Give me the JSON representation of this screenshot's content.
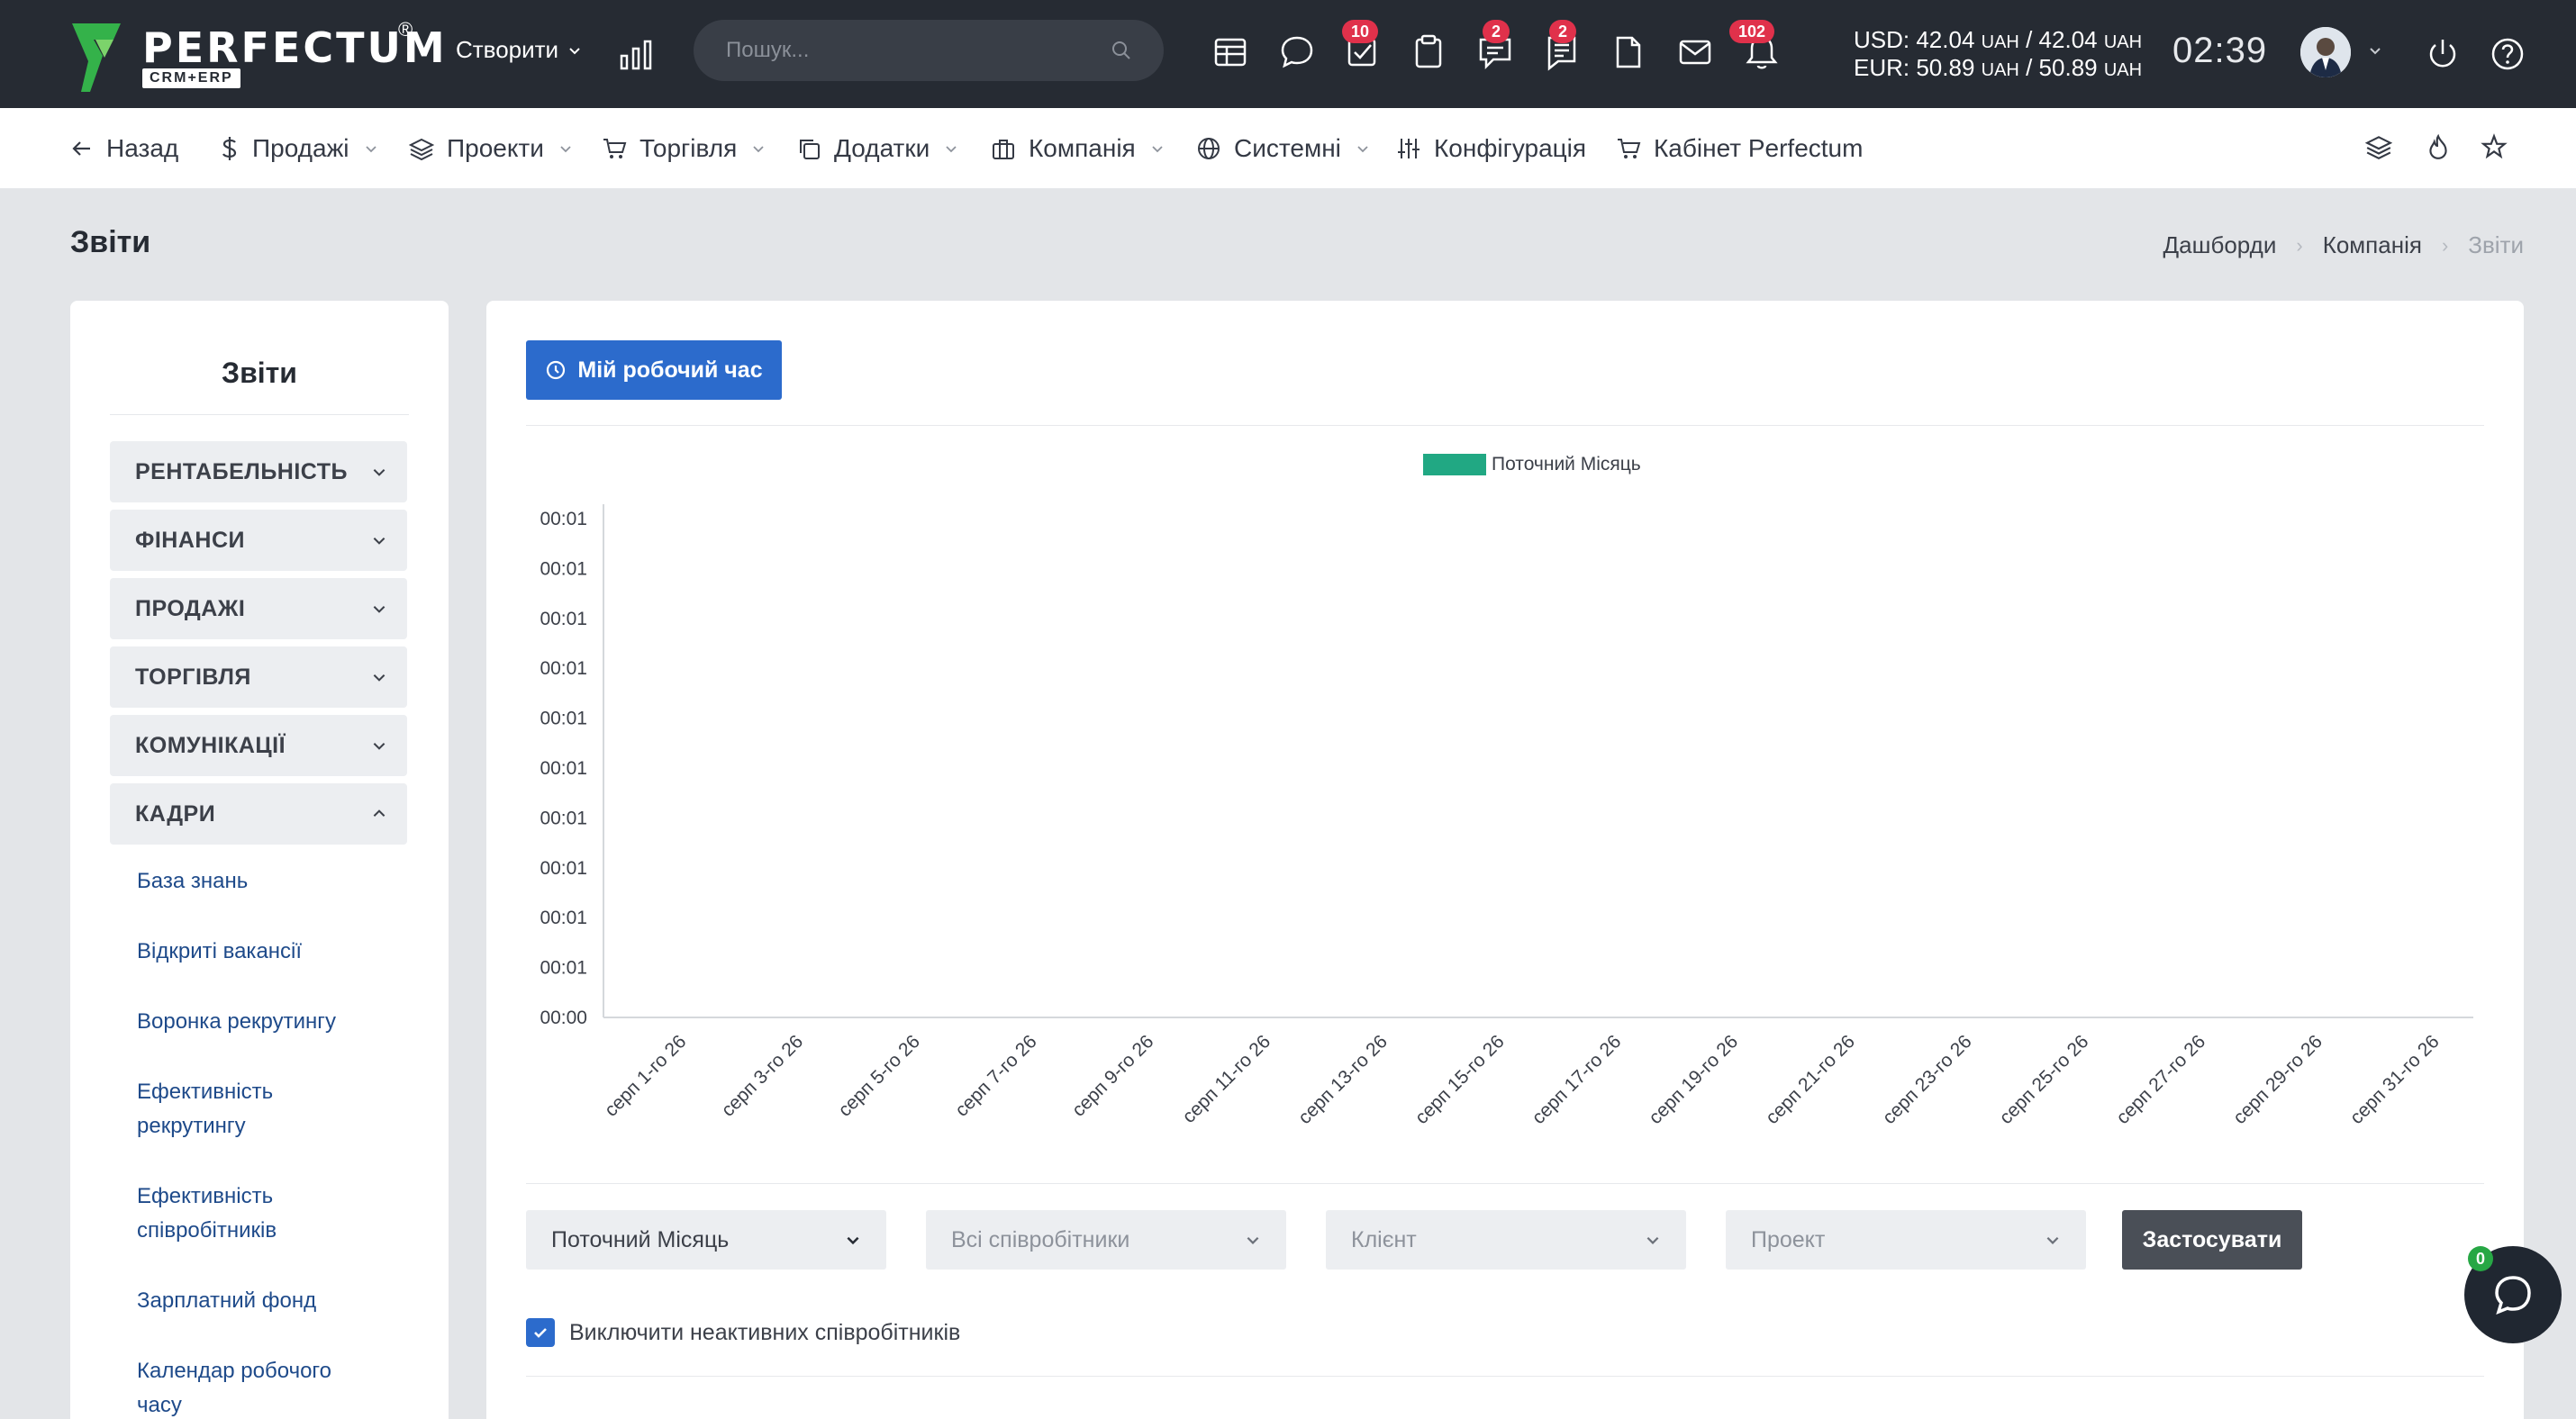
{
  "topbar": {
    "logo_text": "PERFECTUM",
    "logo_sub": "CRM+ERP",
    "logo_reg": "®",
    "create_label": "Створити",
    "search_placeholder": "Пошук...",
    "badges": {
      "tasks": "10",
      "comments": "2",
      "feedback": "2",
      "notifications": "102"
    },
    "currency_usd": "USD: 42.04",
    "currency_usd_unit_1": "UAH",
    "currency_usd_2": "/ 42.04",
    "currency_usd_unit_2": "UAH",
    "currency_eur": "EUR: 50.89",
    "currency_eur_unit_1": "UAH",
    "currency_eur_2": "/ 50.89",
    "currency_eur_unit_2": "UAH",
    "clock": "02:39"
  },
  "nav": {
    "back": "Назад",
    "sales": "Продажі",
    "projects": "Проекти",
    "trade": "Торгівля",
    "addons": "Додатки",
    "company": "Компанія",
    "system": "Системні",
    "config": "Конфігурація",
    "cabinet": "Кабінет Perfectum"
  },
  "page": {
    "title": "Звіти",
    "breadcrumb": [
      "Дашборди",
      "Компанія",
      "Звіти"
    ]
  },
  "sidebar": {
    "title": "Звіти",
    "sections": [
      "РЕНТАБЕЛЬНІСТЬ",
      "ФІНАНСИ",
      "ПРОДАЖІ",
      "ТОРГІВЛЯ",
      "КОМУНІКАЦІЇ",
      "КАДРИ"
    ],
    "hr_links": [
      "База знань",
      "Відкриті вакансії",
      "Воронка рекрутингу",
      "Ефективність рекрутингу",
      "Ефективність співробітників",
      "Зарплатний фонд",
      "Календар робочого часу"
    ]
  },
  "main": {
    "worktime_button": "Мій робочий час",
    "filters": {
      "period": "Поточний Місяць",
      "employees": "Всі співробітники",
      "client": "Клієнт",
      "project": "Проект",
      "apply": "Застосувати"
    },
    "exclude_inactive_label": "Виключити неактивних співробітників",
    "exclude_inactive_checked": true
  },
  "chat": {
    "count": "0"
  },
  "colors": {
    "accent": "#2c6bcc",
    "series": "#21a883",
    "topbar": "#262b33",
    "badge": "#e0314b"
  },
  "chart_data": {
    "type": "bar",
    "legend": [
      "Поточний Місяць"
    ],
    "y_tick_labels": [
      "00:01",
      "00:01",
      "00:01",
      "00:01",
      "00:01",
      "00:01",
      "00:01",
      "00:01",
      "00:01",
      "00:01",
      "00:00"
    ],
    "categories": [
      "серп 1-го 26",
      "серп 3-го 26",
      "серп 5-го 26",
      "серп 7-го 26",
      "серп 9-го 26",
      "серп 11-го 26",
      "серп 13-го 26",
      "серп 15-го 26",
      "серп 17-го 26",
      "серп 19-го 26",
      "серп 21-го 26",
      "серп 23-го 26",
      "серп 25-го 26",
      "серп 27-го 26",
      "серп 29-го 26",
      "серп 31-го 26"
    ],
    "series": [
      {
        "name": "Поточний Місяць",
        "values": [
          0,
          0,
          0,
          0,
          0,
          0,
          0,
          0,
          0,
          0,
          0,
          0,
          0,
          0,
          0,
          0
        ]
      }
    ],
    "legend_position": "top-center",
    "grid": false
  }
}
